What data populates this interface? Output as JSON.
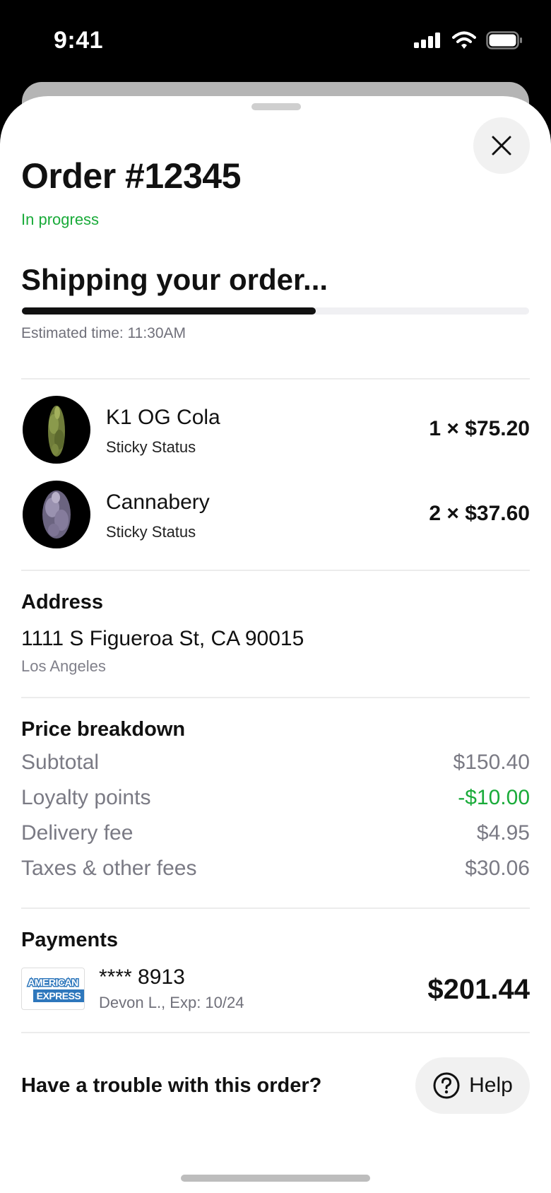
{
  "status_bar": {
    "time": "9:41"
  },
  "order": {
    "title": "Order #12345",
    "status": "In progress",
    "status_color": "#1aab3a",
    "shipping_title": "Shipping your order...",
    "progress_fraction": 0.58,
    "eta": "Estimated time: 11:30AM"
  },
  "items": [
    {
      "name": "K1 OG Cola",
      "brand": "Sticky Status",
      "price": "1 × $75.20",
      "thumb_icon": "cannabis-bud-image"
    },
    {
      "name": "Cannabery",
      "brand": "Sticky Status",
      "price": "2 × $37.60",
      "thumb_icon": "cannabis-bud-image"
    }
  ],
  "address": {
    "heading": "Address",
    "line": "1111 S Figueroa St, CA 90015",
    "city": "Los Angeles"
  },
  "price_breakdown": {
    "heading": "Price breakdown",
    "rows": [
      {
        "label": "Subtotal",
        "value": "$150.40"
      },
      {
        "label": "Loyalty points",
        "value": "-$10.00"
      },
      {
        "label": "Delivery fee",
        "value": "$4.95"
      },
      {
        "label": "Taxes & other fees",
        "value": "$30.06"
      }
    ]
  },
  "payments": {
    "heading": "Payments",
    "card_brand": "AMERICAN EXPRESS",
    "card_brand_line1": "AMERICAN",
    "card_brand_line2": "EXPRESS",
    "card_number": "**** 8913",
    "card_meta": "Devon L., Exp: 10/24",
    "total": "$201.44"
  },
  "footer": {
    "question": "Have a trouble with this order?",
    "help_label": "Help"
  }
}
